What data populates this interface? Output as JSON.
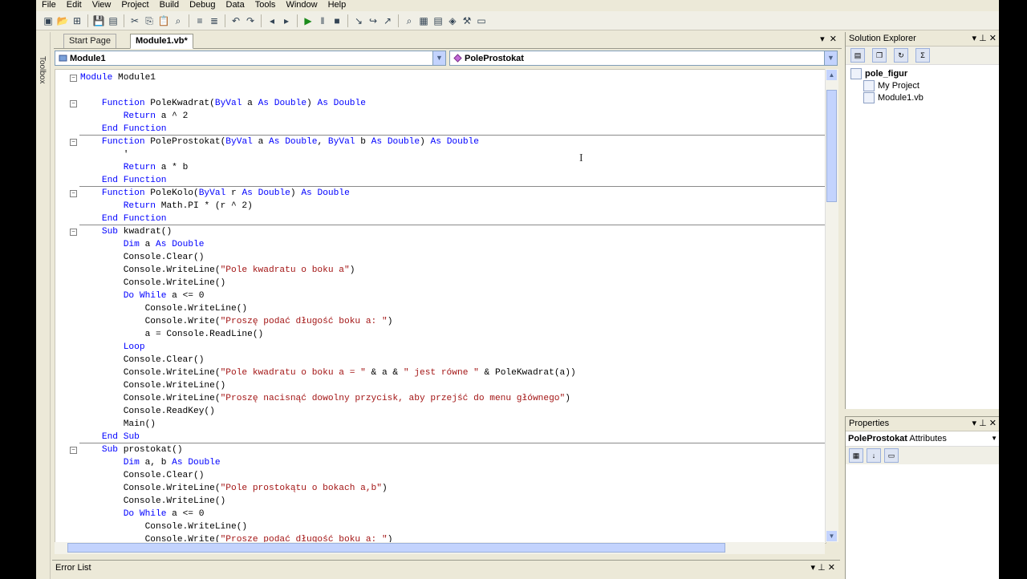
{
  "menu": [
    "File",
    "Edit",
    "View",
    "Project",
    "Build",
    "Debug",
    "Data",
    "Tools",
    "Window",
    "Help"
  ],
  "toolbar_icons": [
    "new-project-icon",
    "open-icon",
    "add-item-icon",
    "save-icon",
    "save-all-icon",
    "cut-icon",
    "copy-icon",
    "paste-icon",
    "find-icon",
    "comment-icon",
    "uncomment-icon",
    "undo-icon",
    "redo-icon",
    "navigate-back-icon",
    "navigate-forward-icon",
    "start-debug-icon",
    "pause-icon",
    "stop-icon",
    "step-into-icon",
    "step-over-icon",
    "step-out-icon",
    "find-in-files-icon",
    "solution-explorer-icon",
    "properties-icon",
    "object-browser-icon",
    "toolbox-icon",
    "start-page-icon"
  ],
  "toolbox_label": "Toolbox",
  "tabs": {
    "start": "Start Page",
    "active": "Module1.vb*"
  },
  "dropdowns": {
    "left": "Module1",
    "right": "PoleProstokat"
  },
  "code_lines": [
    {
      "t": "Module Module1",
      "fold": true
    },
    {
      "t": "",
      "fold": false
    },
    {
      "t": "    Function PoleKwadrat(ByVal a As Double) As Double",
      "fold": true
    },
    {
      "t": "        Return a ^ 2",
      "fold": false
    },
    {
      "t": "    End Function",
      "fold": false
    },
    {
      "t": "    Function PoleProstokat(ByVal a As Double, ByVal b As Double) As Double",
      "fold": true,
      "sep": true
    },
    {
      "t": "        '",
      "fold": false
    },
    {
      "t": "        Return a * b",
      "fold": false
    },
    {
      "t": "    End Function",
      "fold": false
    },
    {
      "t": "    Function PoleKolo(ByVal r As Double) As Double",
      "fold": true,
      "sep": true
    },
    {
      "t": "        Return Math.PI * (r ^ 2)",
      "fold": false
    },
    {
      "t": "    End Function",
      "fold": false
    },
    {
      "t": "    Sub kwadrat()",
      "fold": true,
      "sep": true
    },
    {
      "t": "        Dim a As Double",
      "fold": false
    },
    {
      "t": "        Console.Clear()",
      "fold": false
    },
    {
      "t": "        Console.WriteLine(\"Pole kwadratu o boku a\")",
      "fold": false
    },
    {
      "t": "        Console.WriteLine()",
      "fold": false
    },
    {
      "t": "        Do While a <= 0",
      "fold": false
    },
    {
      "t": "            Console.WriteLine()",
      "fold": false
    },
    {
      "t": "            Console.Write(\"Proszę podać długość boku a: \")",
      "fold": false
    },
    {
      "t": "            a = Console.ReadLine()",
      "fold": false
    },
    {
      "t": "        Loop",
      "fold": false
    },
    {
      "t": "        Console.Clear()",
      "fold": false
    },
    {
      "t": "        Console.WriteLine(\"Pole kwadratu o boku a = \" & a & \" jest równe \" & PoleKwadrat(a))",
      "fold": false
    },
    {
      "t": "        Console.WriteLine()",
      "fold": false
    },
    {
      "t": "        Console.WriteLine(\"Proszę nacisnąć dowolny przycisk, aby przejść do menu głównego\")",
      "fold": false
    },
    {
      "t": "        Console.ReadKey()",
      "fold": false
    },
    {
      "t": "        Main()",
      "fold": false
    },
    {
      "t": "    End Sub",
      "fold": false
    },
    {
      "t": "    Sub prostokat()",
      "fold": true,
      "sep": true
    },
    {
      "t": "        Dim a, b As Double",
      "fold": false
    },
    {
      "t": "        Console.Clear()",
      "fold": false
    },
    {
      "t": "        Console.WriteLine(\"Pole prostokątu o bokach a,b\")",
      "fold": false
    },
    {
      "t": "        Console.WriteLine()",
      "fold": false
    },
    {
      "t": "        Do While a <= 0",
      "fold": false
    },
    {
      "t": "            Console.WriteLine()",
      "fold": false
    },
    {
      "t": "            Console.Write(\"Prosze podać długość boku a: \")",
      "fold": false
    }
  ],
  "error_list": "Error List",
  "solution_explorer": {
    "title": "Solution Explorer",
    "items": [
      "pole_figur",
      "My Project",
      "Module1.vb"
    ]
  },
  "properties": {
    "title": "Properties",
    "object": "PoleProstokat",
    "kind": "Attributes"
  }
}
